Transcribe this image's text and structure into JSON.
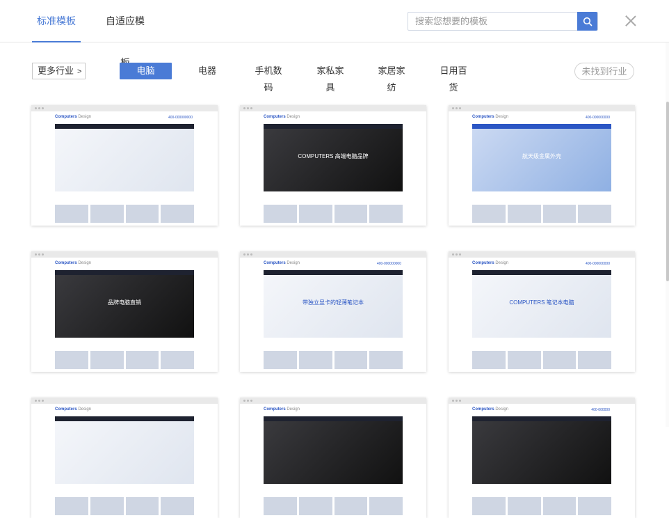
{
  "tabs": [
    {
      "label": "标准模板",
      "active": true
    },
    {
      "label": "自适应模板",
      "active": false
    }
  ],
  "search": {
    "placeholder": "搜索您想要的模板",
    "value": ""
  },
  "filter": {
    "more_label": "更多行业",
    "more_chevron": ">",
    "categories": [
      {
        "label": "电脑",
        "active": true
      },
      {
        "label": "电器",
        "active": false
      },
      {
        "label": "手机数码",
        "active": false
      },
      {
        "label": "家私家具",
        "active": false
      },
      {
        "label": "家居家纺",
        "active": false
      },
      {
        "label": "日用百货",
        "active": false
      }
    ],
    "not_found_label": "未找到行业"
  },
  "templates": [
    {
      "brand": "Computers",
      "brand_sub": "Design",
      "phone": "400-000000000",
      "hero_text": "",
      "theme": "light",
      "accent": "#2b56c4"
    },
    {
      "brand": "Computers",
      "brand_sub": "Design",
      "phone": "",
      "hero_text": "COMPUTERS 高端电脑品牌",
      "theme": "dark",
      "accent": "#2b56c4"
    },
    {
      "brand": "Computers",
      "brand_sub": "Design",
      "phone": "400-000000000",
      "hero_text": "航天级金属外壳",
      "theme": "blue",
      "accent": "#2b56c4"
    },
    {
      "brand": "Computers",
      "brand_sub": "Design",
      "phone": "",
      "hero_text": "品牌电脑直销",
      "theme": "dark",
      "accent": "#2b56c4"
    },
    {
      "brand": "Computers",
      "brand_sub": "Design",
      "phone": "400-000000000",
      "hero_text": "带独立显卡的轻薄笔记本",
      "theme": "light",
      "accent": "#2b56c4"
    },
    {
      "brand": "Computers",
      "brand_sub": "Design",
      "phone": "400-000000000",
      "hero_text": "COMPUTERS 笔记本电脑",
      "theme": "light",
      "accent": "#2b56c4"
    },
    {
      "brand": "Computers",
      "brand_sub": "Design",
      "phone": "",
      "hero_text": "",
      "theme": "light",
      "accent": "#2b56c4"
    },
    {
      "brand": "Computers",
      "brand_sub": "Design",
      "phone": "",
      "hero_text": "",
      "theme": "dark",
      "accent": "#2b56c4"
    },
    {
      "brand": "Computers",
      "brand_sub": "Design",
      "phone": "400-000000",
      "hero_text": "",
      "theme": "dark",
      "accent": "#2b56c4"
    }
  ],
  "colors": {
    "accent": "#4a7bd6",
    "border": "#e6e6e6"
  },
  "icons": {
    "search": "search-icon",
    "close": "close-icon"
  }
}
